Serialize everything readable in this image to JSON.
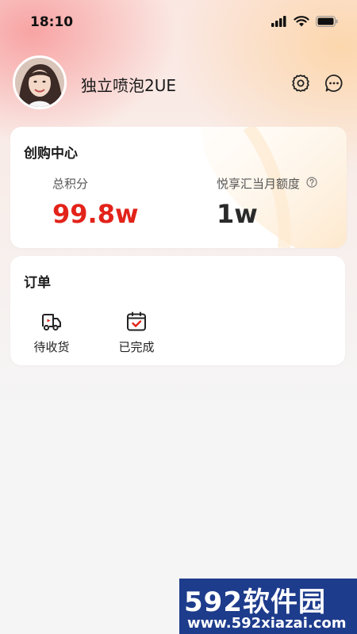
{
  "status": {
    "time": "18:10"
  },
  "profile": {
    "username": "独立喷泡2UE"
  },
  "creator_center": {
    "title": "创购中心",
    "points_label": "总积分",
    "points_value": "99.8w",
    "quota_label": "悦享汇当月额度",
    "quota_value": "1w"
  },
  "orders": {
    "title": "订单",
    "items": [
      {
        "label": "待收货",
        "icon": "truck-icon"
      },
      {
        "label": "已完成",
        "icon": "calendar-check-icon"
      }
    ]
  },
  "watermark": {
    "brand": "592软件园",
    "url": "www.592xiazai.com"
  },
  "colors": {
    "accent_red": "#e2231a",
    "value_dark": "#2a2a2a"
  }
}
